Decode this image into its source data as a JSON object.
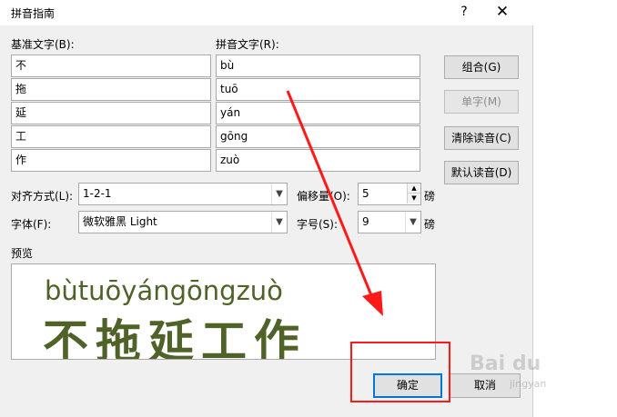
{
  "dialog": {
    "title": "拼音指南",
    "help_symbol": "?",
    "close_symbol": "✕"
  },
  "headers": {
    "base_text": "基准文字(B):",
    "ruby_text": "拼音文字(R):"
  },
  "rows": [
    {
      "base": "不",
      "ruby": "bù"
    },
    {
      "base": "拖",
      "ruby": "tuō"
    },
    {
      "base": "延",
      "ruby": "yán"
    },
    {
      "base": "工",
      "ruby": "gōng"
    },
    {
      "base": "作",
      "ruby": "zuò"
    }
  ],
  "buttons": {
    "group": "组合(G)",
    "mono": "单字(M)",
    "clear": "清除读音(C)",
    "default": "默认读音(D)",
    "ok": "确定",
    "cancel": "取消"
  },
  "options": {
    "alignment_label": "对齐方式(L):",
    "alignment_value": "1-2-1",
    "offset_label": "偏移量(O):",
    "offset_value": "5",
    "offset_unit": "磅",
    "font_label": "字体(F):",
    "font_value": "微软雅黑 Light",
    "size_label": "字号(S):",
    "size_value": "9",
    "size_unit": "磅"
  },
  "preview": {
    "label": "预览",
    "pinyin": [
      "bù",
      "tuō",
      "yán",
      "gōng",
      "zuò"
    ],
    "hanzi": [
      "不",
      "拖",
      "延",
      "工",
      "作"
    ]
  },
  "annotation": {
    "color": "#ff1a1a"
  },
  "watermark": {
    "brand": "Bai du",
    "sub": "jingyan"
  },
  "colors": {
    "preview_text": "#4f6228",
    "focus_border": "#0078d7"
  }
}
